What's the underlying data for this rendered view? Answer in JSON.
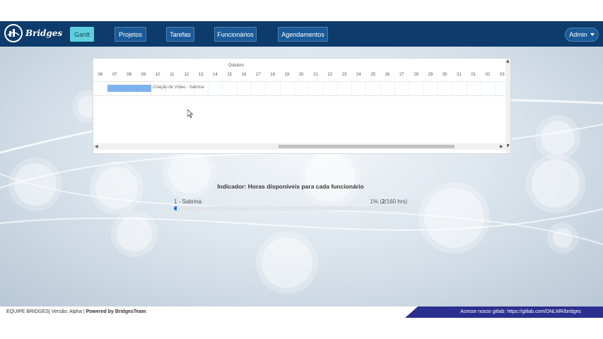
{
  "brand": {
    "name": "Bridges"
  },
  "nav": {
    "items": [
      {
        "label": "Gantt",
        "active": true
      },
      {
        "label": "Projetos"
      },
      {
        "label": "Tarefas"
      },
      {
        "label": "Funcionários"
      },
      {
        "label": "Agendamentos"
      }
    ],
    "user_label": "Admin"
  },
  "gantt": {
    "month": "Outubro",
    "days": [
      "06",
      "07",
      "08",
      "09",
      "10",
      "11",
      "12",
      "13",
      "14",
      "15",
      "16",
      "17",
      "18",
      "19",
      "20",
      "21",
      "22",
      "23",
      "24",
      "25",
      "26",
      "27",
      "28",
      "29",
      "30",
      "31",
      "01",
      "02",
      "03"
    ],
    "task": {
      "label": "Criação de Vídeo - Sabrina"
    }
  },
  "indicator": {
    "title": "Indicador: Horas disponíveis para cada funcionário",
    "employee": "1 - Sabrina",
    "percent_text": "1% (",
    "hours_used": "2",
    "hours_total_text": "/160 hrs)",
    "progress_fraction": 0.0125
  },
  "footer": {
    "team": "EQUIPE BRIDGES",
    "version": "| Versão: Alpha |",
    "powered": "Powered by BridgesTeam",
    "gitlab": "Acesse nosso gitlab: https://gitlab.com/DNLMR/bridges"
  },
  "colors": {
    "navbar": "#0d3b6b",
    "active_button": "#5fd0db",
    "task_bar": "#7eb2ef",
    "footer_accent": "#2b2f8f"
  }
}
